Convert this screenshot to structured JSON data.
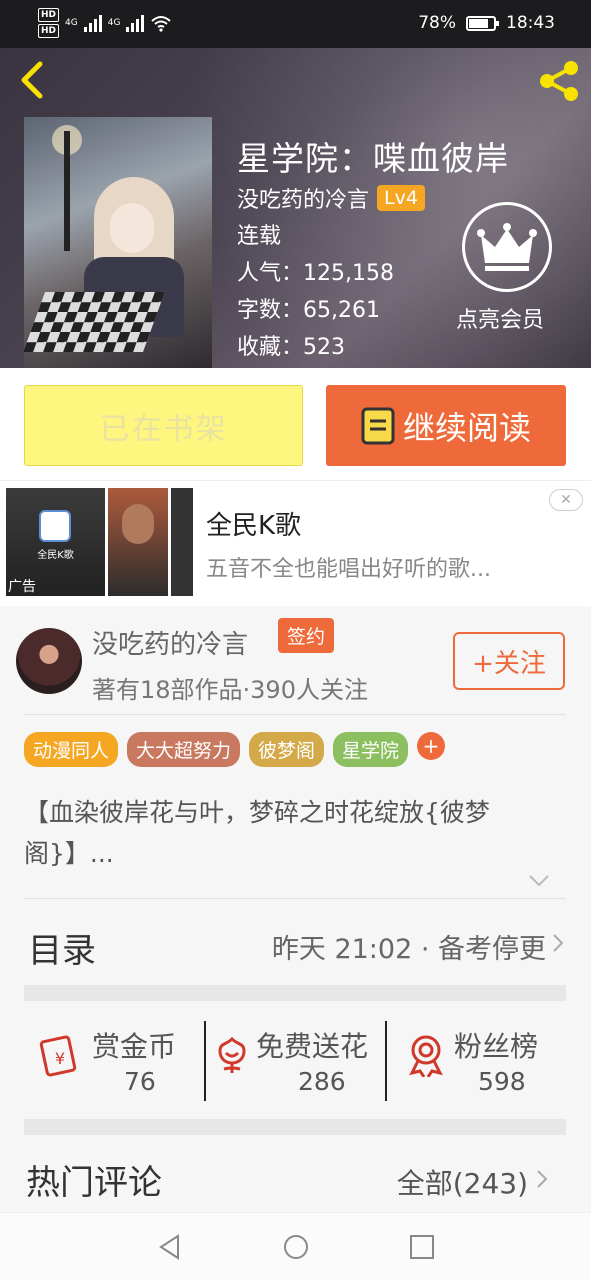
{
  "status_bar": {
    "network_1": "4G",
    "network_2": "4G",
    "battery": "78%",
    "battery_level": 0.78,
    "time": "18:43"
  },
  "book": {
    "title": "星学院：喋血彼岸",
    "author": "没吃药的冷言",
    "level": "Lv4",
    "status": "连载",
    "popularity": "人气：125,158",
    "word_count": "字数：65,261",
    "favorites": "收藏：523",
    "vip_label": "点亮会员"
  },
  "actions": {
    "shelf_label": "已在书架",
    "read_label": "继续阅读"
  },
  "ad": {
    "title": "全民K歌",
    "description": "五音不全也能唱出好听的歌...",
    "tag": "广告",
    "close": "✕",
    "thumb_text": "全民K歌"
  },
  "author_info": {
    "name": "没吃药的冷言",
    "sign_badge": "签约",
    "stats": "著有18部作品·390人关注",
    "follow_label": "+关注"
  },
  "tags": [
    {
      "label": "动漫同人",
      "color": "#f5a623"
    },
    {
      "label": "大大超努力",
      "color": "#c9795f"
    },
    {
      "label": "彼梦阁",
      "color": "#d4a94a"
    },
    {
      "label": "星学院",
      "color": "#8cbf5f"
    }
  ],
  "synopsis": "【血染彼岸花与叶，梦碎之时花绽放{彼梦阁}】...",
  "toc": {
    "label": "目录",
    "update": "昨天 21:02 · 备考停更"
  },
  "stats": [
    {
      "label": "赏金币",
      "value": "76",
      "icon": "coin-envelope-icon"
    },
    {
      "label": "免费送花",
      "value": "286",
      "icon": "flower-icon"
    },
    {
      "label": "粉丝榜",
      "value": "598",
      "icon": "medal-icon"
    }
  ],
  "comments": {
    "title": "热门评论",
    "all_label": "全部(243)"
  },
  "colors": {
    "accent": "#ee6a3a",
    "shelf_bg": "#fef67f",
    "level_badge": "#f5a623"
  }
}
